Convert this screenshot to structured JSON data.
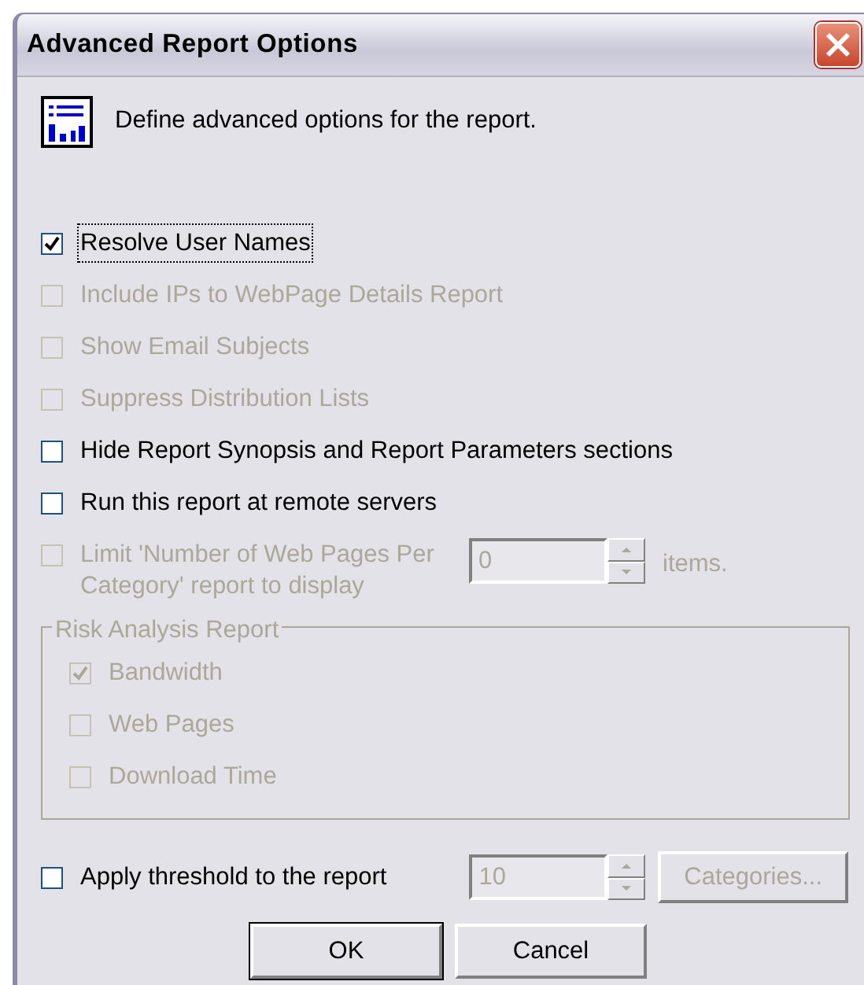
{
  "window": {
    "title": "Advanced Report Options"
  },
  "header": {
    "text": "Define advanced options for the report."
  },
  "options": [
    {
      "kind": "checkbox",
      "label": "Resolve User Names",
      "checked": true,
      "disabled": false,
      "focused": true
    },
    {
      "kind": "checkbox",
      "label": "Include IPs to WebPage Details Report",
      "checked": false,
      "disabled": true,
      "focused": false
    },
    {
      "kind": "checkbox",
      "label": "Show Email Subjects",
      "checked": false,
      "disabled": true,
      "focused": false
    },
    {
      "kind": "checkbox",
      "label": "Suppress Distribution Lists",
      "checked": false,
      "disabled": true,
      "focused": false
    },
    {
      "kind": "checkbox",
      "label": "Hide Report Synopsis and Report Parameters sections",
      "checked": false,
      "disabled": false,
      "focused": false
    },
    {
      "kind": "checkbox",
      "label": "Run this report at remote servers",
      "checked": false,
      "disabled": false,
      "focused": false
    },
    {
      "kind": "limit",
      "label": "Limit 'Number of Web Pages Per Category' report to display",
      "checked": false,
      "disabled": true,
      "focused": false,
      "value": "0",
      "suffix": "items."
    }
  ],
  "risk_group": {
    "title": "Risk Analysis Report",
    "disabled": true,
    "items": [
      {
        "label": "Bandwidth",
        "checked": true
      },
      {
        "label": "Web Pages",
        "checked": false
      },
      {
        "label": "Download Time",
        "checked": false
      }
    ]
  },
  "threshold": {
    "label": "Apply threshold to the report",
    "checked": false,
    "disabled": false,
    "value": "10",
    "value_disabled": true,
    "button": "Categories...",
    "button_disabled": true
  },
  "buttons": [
    {
      "label": "OK",
      "default": true
    },
    {
      "label": "Cancel",
      "default": false
    }
  ]
}
